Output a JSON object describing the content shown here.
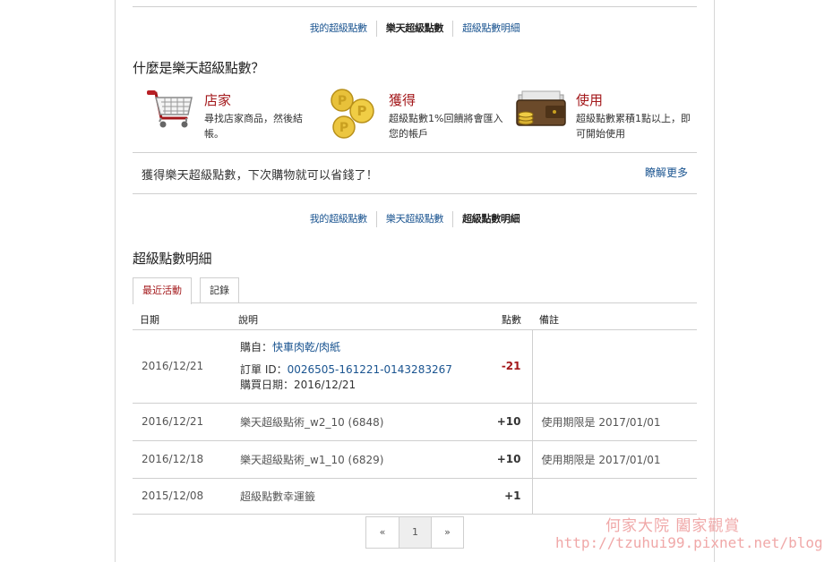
{
  "nav": {
    "my_points": "我的超級點數",
    "about_points": "樂天超級點數",
    "points_detail": "超級點數明細"
  },
  "about": {
    "title": "什麼是樂天超級點數？",
    "features": [
      {
        "icon": "shopping-cart-icon",
        "title": "店家",
        "desc": "尋找店家商品，然後結帳。"
      },
      {
        "icon": "gold-coins-icon",
        "title": "獲得",
        "desc": "超級點數1%回饋將會匯入您的帳戶"
      },
      {
        "icon": "wallet-icon",
        "title": "使用",
        "desc": "超級點數累積1點以上，即可開始使用"
      }
    ],
    "promo": "獲得樂天超級點數，下次購物就可以省錢了！",
    "learn_more": "瞭解更多"
  },
  "detail": {
    "title": "超級點數明細",
    "tabs": [
      "最近活動",
      "記錄"
    ],
    "columns": [
      "日期",
      "說明",
      "點數",
      "備註"
    ],
    "rows": [
      {
        "date": "2016/12/21",
        "purchase_label": "購自：",
        "purchase_shop": "快車肉乾/肉紙",
        "order_label": "訂單 ID：",
        "order_id": "0026505-161221-0143283267",
        "buy_date_label": "購買日期：",
        "buy_date": "2016/12/21",
        "points": "-21",
        "note": ""
      },
      {
        "date": "2016/12/21",
        "desc": "樂天超級點術_w2_10 (6848)",
        "points": "+10",
        "note": "使用期限是 2017/01/01"
      },
      {
        "date": "2016/12/18",
        "desc": "樂天超級點術_w1_10 (6829)",
        "points": "+10",
        "note": "使用期限是 2017/01/01"
      },
      {
        "date": "2015/12/08",
        "desc": "超級點數幸運籤",
        "points": "+1",
        "note": ""
      }
    ]
  },
  "pager": {
    "prev": "«",
    "current": "1",
    "next": "»"
  },
  "watermark": {
    "line1": "何家大院 闔家觀賞",
    "line2": "http://tzuhui99.pixnet.net/blog"
  },
  "colors": {
    "accent_red": "#a3181b",
    "link_blue": "#1a5490",
    "border": "#cfcfcf",
    "watermark": "#f0a8a8"
  }
}
